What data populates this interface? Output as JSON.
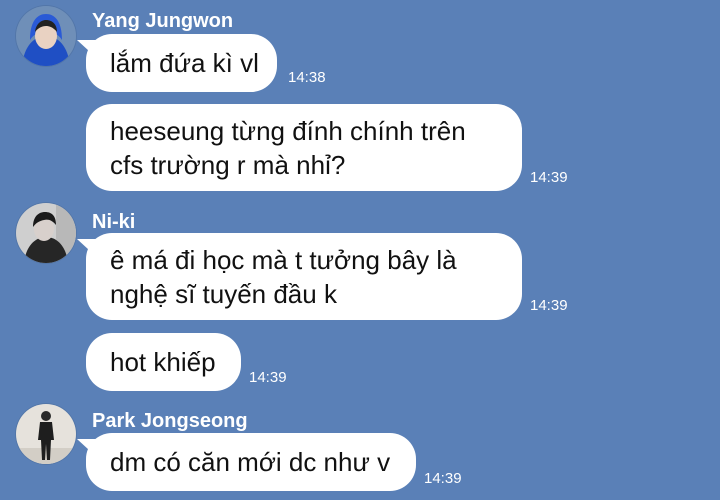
{
  "chat": {
    "groups": [
      {
        "sender": "Yang Jungwon",
        "avatar_icon": "avatar-blue-hoodie",
        "messages": [
          {
            "lines": [
              "lắm đứa kì vl"
            ],
            "time": "14:38"
          },
          {
            "lines": [
              "heeseung từng đính chính trên",
              "cfs trường r mà nhỉ?"
            ],
            "time": "14:39"
          }
        ]
      },
      {
        "sender": "Ni-ki",
        "avatar_icon": "avatar-monochrome",
        "messages": [
          {
            "lines": [
              "ê má đi học mà t tưởng bây là",
              "nghệ sĩ tuyến đầu k"
            ],
            "time": "14:39"
          },
          {
            "lines": [
              "hot khiếp"
            ],
            "time": "14:39"
          }
        ]
      },
      {
        "sender": "Park Jongseong",
        "avatar_icon": "avatar-standing-figure",
        "messages": [
          {
            "lines": [
              "dm có căn mới dc như v"
            ],
            "time": "14:39"
          }
        ]
      }
    ]
  },
  "colors": {
    "background": "#5a80b7",
    "bubble": "#ffffff",
    "text": "#111111",
    "meta_text": "#ffffff"
  }
}
